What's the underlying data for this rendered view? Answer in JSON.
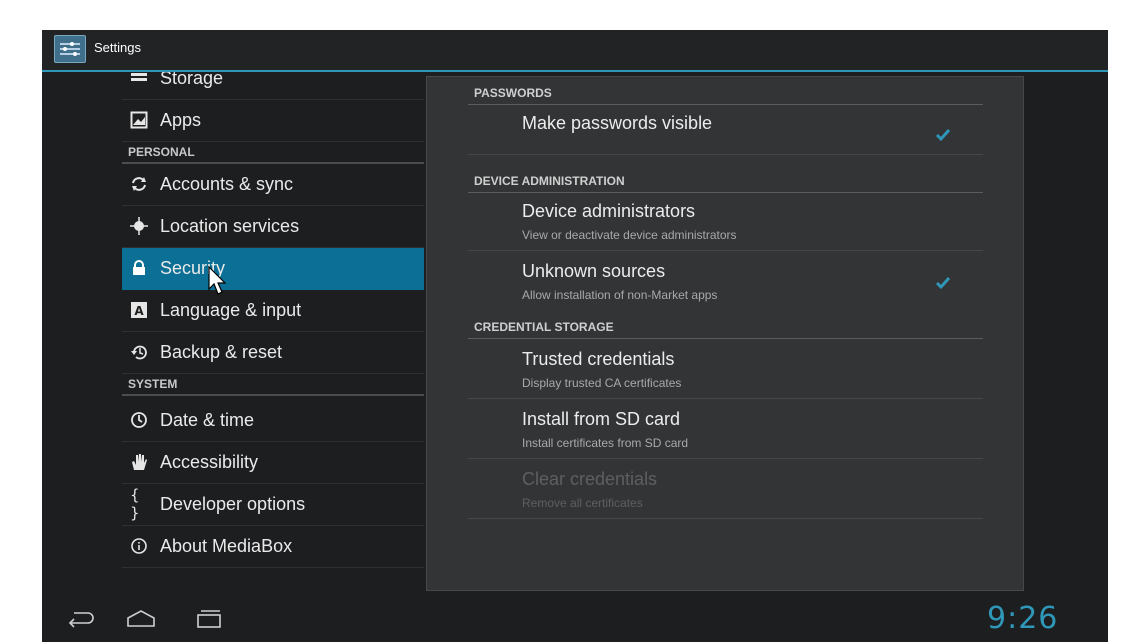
{
  "app": {
    "title": "Settings"
  },
  "left_menu": {
    "items": [
      {
        "icon": "storage-icon",
        "label": "Storage"
      },
      {
        "icon": "apps-icon",
        "label": "Apps"
      },
      {
        "header": "PERSONAL"
      },
      {
        "icon": "sync-icon",
        "label": "Accounts & sync"
      },
      {
        "icon": "location-icon",
        "label": "Location services"
      },
      {
        "icon": "lock-icon",
        "label": "Security",
        "selected": true
      },
      {
        "icon": "language-icon",
        "label": "Language & input"
      },
      {
        "icon": "backup-icon",
        "label": "Backup & reset"
      },
      {
        "header": "SYSTEM"
      },
      {
        "icon": "clock-icon",
        "label": "Date & time"
      },
      {
        "icon": "accessibility-icon",
        "label": "Accessibility"
      },
      {
        "icon": "braces-icon",
        "label": "Developer options"
      },
      {
        "icon": "info-icon",
        "label": "About MediaBox"
      }
    ]
  },
  "security": {
    "passwords_header": "PASSWORDS",
    "make_passwords_visible": {
      "title": "Make passwords visible",
      "checked": true
    },
    "device_admin_header": "DEVICE ADMINISTRATION",
    "device_administrators": {
      "title": "Device administrators",
      "summary": "View or deactivate device administrators"
    },
    "unknown_sources": {
      "title": "Unknown sources",
      "summary": "Allow installation of non-Market apps",
      "checked": true
    },
    "credential_storage_header": "CREDENTIAL STORAGE",
    "trusted_credentials": {
      "title": "Trusted credentials",
      "summary": "Display trusted CA certificates"
    },
    "install_from_sd": {
      "title": "Install from SD card",
      "summary": "Install certificates from SD card"
    },
    "clear_credentials": {
      "title": "Clear credentials",
      "summary": "Remove all certificates",
      "enabled": false
    }
  },
  "status": {
    "time": "9:26"
  },
  "colors": {
    "accent": "#2f97b8",
    "selected": "#0c6f95",
    "background": "#1d1e20",
    "panel": "#323436"
  }
}
